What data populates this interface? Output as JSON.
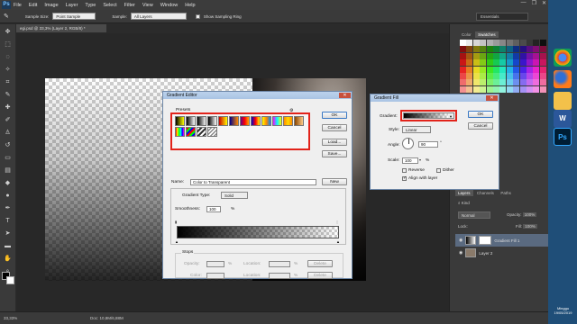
{
  "menubar": {
    "logo": "Ps",
    "items": [
      "File",
      "Edit",
      "Image",
      "Layer",
      "Type",
      "Select",
      "Filter",
      "View",
      "Window",
      "Help"
    ],
    "window_controls": [
      "—",
      "❐",
      "✕"
    ]
  },
  "options": {
    "sample_size_label": "Sample Size:",
    "sample_size_value": "Point Sample",
    "sample_label": "Sample:",
    "sample_value": "All Layers",
    "show_ring_label": "Show Sampling Ring"
  },
  "document": {
    "tab_title": "egi.psd @ 33,3% (Layer 2, RGB/8) *",
    "zoom": "33,33%",
    "doc_info": "Doc: 10,8M/6,88M"
  },
  "workspace": {
    "essentials": "Essentials"
  },
  "color_panel": {
    "tabs": [
      "Color",
      "Swatches"
    ]
  },
  "layers_panel": {
    "tabs": [
      "Layers",
      "Channels",
      "Paths"
    ],
    "kind_label": "Kind",
    "blend_mode": "Normal",
    "opacity_label": "Opacity:",
    "opacity_value": "100%",
    "lock_label": "Lock:",
    "fill_label": "Fill:",
    "fill_value": "100%",
    "layers": [
      {
        "name": "Gradient Fill 1",
        "selected": true
      },
      {
        "name": "Layer 2",
        "selected": false
      }
    ]
  },
  "gradient_editor": {
    "title": "Gradient Editor",
    "presets_label": "Presets",
    "ok": "OK",
    "cancel": "Cancel",
    "load": "Load...",
    "save": "Save...",
    "name_label": "Name:",
    "name_value": "Color to Transparent",
    "new_button": "New",
    "gradient_type_label": "Gradient Type:",
    "gradient_type_value": "Solid",
    "smoothness_label": "Smoothness:",
    "smoothness_value": "100",
    "smoothness_unit": "%",
    "stops_label": "Stops",
    "opacity_label": "Opacity:",
    "location_label": "Location:",
    "color_label": "Color:",
    "percent": "%",
    "delete_label": "Delete"
  },
  "gradient_fill": {
    "title": "Gradient Fill",
    "gradient_label": "Gradient:",
    "ok": "OK",
    "cancel": "Cancel",
    "style_label": "Style:",
    "style_value": "Linear",
    "angle_label": "Angle:",
    "angle_value": "90",
    "angle_unit": "°",
    "scale_label": "Scale:",
    "scale_value": "100",
    "scale_unit": "%",
    "reverse_label": "Reverse",
    "dither_label": "Dither",
    "align_label": "Align with layer",
    "reverse_checked": false,
    "dither_checked": false,
    "align_checked": true
  },
  "taskbar": {
    "clock_day": "Minggu",
    "clock_date": "19/05/2019",
    "icons": [
      "chrome-icon",
      "firefox-icon",
      "folder-icon",
      "word-icon",
      "photoshop-icon"
    ]
  },
  "colors": {
    "accent_red": "#e2231a",
    "taskbar_blue": "#1f4e78",
    "dialog_title": "#bcd2ec"
  }
}
